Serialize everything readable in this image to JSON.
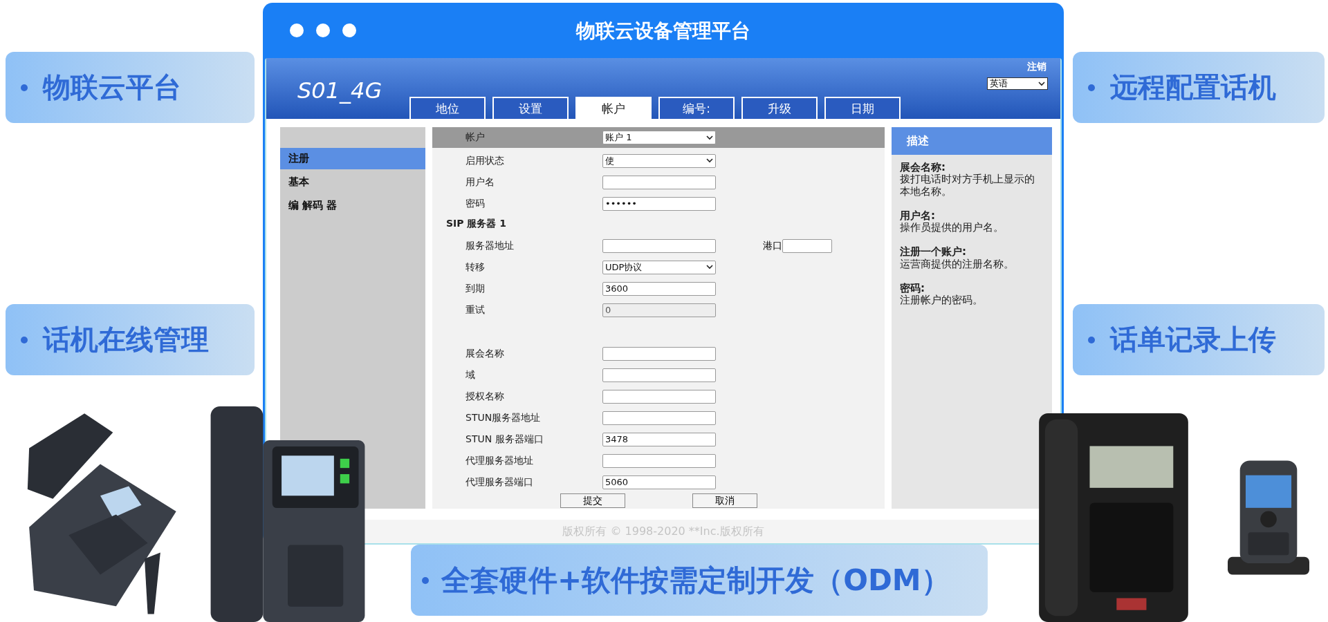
{
  "left_labels": [
    {
      "text": "物联云平台"
    },
    {
      "text": "话机在线管理"
    }
  ],
  "right_labels": [
    {
      "text": "远程配置话机"
    },
    {
      "text": "话单记录上传"
    }
  ],
  "bottom_banner": {
    "text": "全套硬件+软件按需定制开发（ODM）"
  },
  "window": {
    "title": "物联云设备管理平台"
  },
  "app": {
    "model": "S01_4G",
    "logout": "注销",
    "language": "英语",
    "tabs": [
      {
        "label": "地位",
        "selected": false
      },
      {
        "label": "设置",
        "selected": false
      },
      {
        "label": "帐户",
        "selected": true
      },
      {
        "label": "编号:",
        "selected": false
      },
      {
        "label": "升级",
        "selected": false
      },
      {
        "label": "日期",
        "selected": false
      }
    ],
    "nav": [
      {
        "label": "注册",
        "selected": true
      },
      {
        "label": "基本",
        "selected": false
      },
      {
        "label": "编 解码 器",
        "selected": false
      }
    ],
    "form": {
      "header": {
        "label": "帐户",
        "value": "账户 1"
      },
      "groups": [
        {
          "rows": [
            {
              "kind": "select",
              "label": "启用状态",
              "value": "使"
            },
            {
              "kind": "input",
              "label": "用户名"
            },
            {
              "kind": "password",
              "label": "密码",
              "value": "••••••"
            }
          ]
        },
        {
          "heading": "SIP 服务器 1",
          "rows": [
            {
              "kind": "input",
              "label": "服务器地址",
              "extra_label": "港口"
            },
            {
              "kind": "select",
              "label": "转移",
              "value": "UDP协议"
            },
            {
              "kind": "input",
              "label": "到期",
              "value": "3600"
            },
            {
              "kind": "disabled",
              "label": "重试",
              "value": "0"
            }
          ]
        },
        {
          "rows": [
            {
              "kind": "input",
              "label": "展会名称"
            },
            {
              "kind": "input",
              "label": "域"
            },
            {
              "kind": "input",
              "label": "授权名称"
            },
            {
              "kind": "input",
              "label": "STUN服务器地址"
            },
            {
              "kind": "input",
              "label": "STUN 服务器端口",
              "value": "3478"
            },
            {
              "kind": "input",
              "label": "代理服务器地址"
            },
            {
              "kind": "input",
              "label": "代理服务器端口",
              "value": "5060"
            }
          ]
        }
      ],
      "buttons": [
        "提交",
        "取消"
      ]
    },
    "description": {
      "title": "描述",
      "items": [
        {
          "term": "展会名称:",
          "text": "拨打电话时对方手机上显示的本地名称。"
        },
        {
          "term": "用户名:",
          "text": "操作员提供的用户名。"
        },
        {
          "term": "注册一个账户:",
          "text": "运营商提供的注册名称。"
        },
        {
          "term": "密码:",
          "text": "注册帐户的密码。"
        }
      ]
    },
    "footer": "版权所有 © 1998-2020 **Inc.版权所有"
  }
}
